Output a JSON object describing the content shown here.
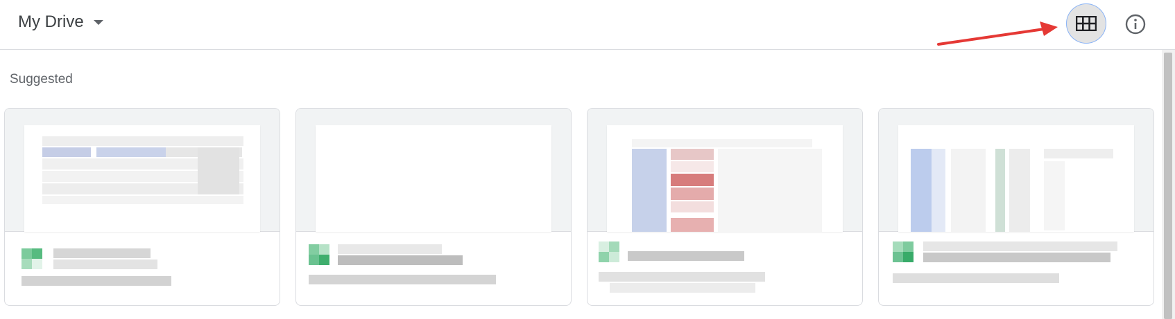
{
  "header": {
    "title": "My Drive"
  },
  "section": {
    "title": "Suggested"
  },
  "icons": {
    "dropdown": "caret-down-icon",
    "grid_view": "grid-view-icon",
    "info": "info-icon",
    "annotation": "red-arrow-annotation"
  },
  "colors": {
    "accent": "#1a73e8",
    "annotation_arrow": "#e53935",
    "sheets_green": "#34a853"
  },
  "suggested_files": [
    {
      "type": "spreadsheet",
      "name": "",
      "subtitle": ""
    },
    {
      "type": "spreadsheet",
      "name": "",
      "subtitle": ""
    },
    {
      "type": "spreadsheet",
      "name": "",
      "subtitle": ""
    },
    {
      "type": "spreadsheet",
      "name": "",
      "subtitle": ""
    }
  ]
}
